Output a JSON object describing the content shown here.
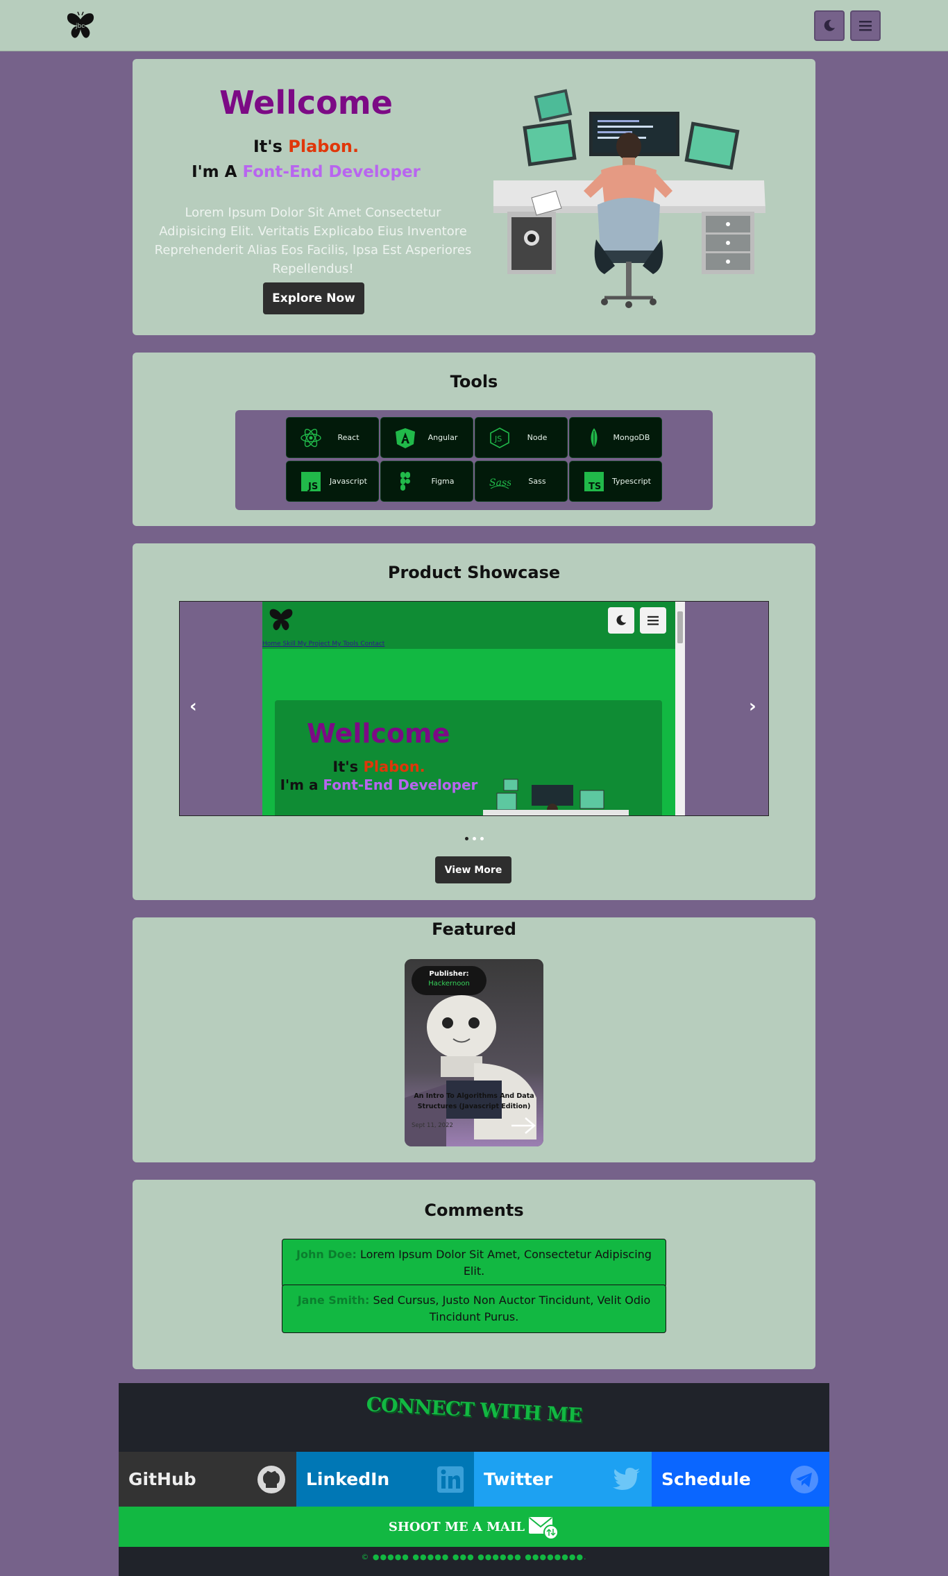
{
  "header": {
    "logo_icon": "butterfly-logo-icon",
    "theme_icon": "moon-icon",
    "menu_icon": "hamburger-menu-icon"
  },
  "hero": {
    "title": "Wellcome",
    "intro_prefix": "It's ",
    "intro_name": "Plabon.",
    "role_prefix": "I'm A ",
    "role": "Font-End Developer",
    "description": "Lorem Ipsum Dolor Sit Amet Consectetur Adipisicing Elit. Veritatis Explicabo Eius Inventore Reprehenderit Alias Eos Facilis, Ipsa Est Asperiores Repellendus!",
    "button_label": "Explore Now",
    "illustration": "developer-at-desk-illustration"
  },
  "tools": {
    "title": "Tools",
    "items": [
      {
        "label": "React",
        "icon": "react-icon"
      },
      {
        "label": "Angular",
        "icon": "angular-icon"
      },
      {
        "label": "Node",
        "icon": "nodejs-icon"
      },
      {
        "label": "MongoDB",
        "icon": "mongodb-icon"
      },
      {
        "label": "Javascript",
        "icon": "javascript-icon"
      },
      {
        "label": "Figma",
        "icon": "figma-icon"
      },
      {
        "label": "Sass",
        "icon": "sass-icon"
      },
      {
        "label": "Typescript",
        "icon": "typescript-icon"
      }
    ]
  },
  "showcase": {
    "title": "Product Showcase",
    "prev_label": "‹",
    "next_label": "›",
    "slide": {
      "nav_links": "Home Skill My Project My Tools Contact",
      "title": "Wellcome",
      "intro_prefix": "It's ",
      "intro_name": "Plabon.",
      "role_prefix": "I'm a ",
      "role": "Font-End Developer"
    },
    "slide_count": 3,
    "active_slide": 1,
    "button_label": "View More"
  },
  "featured": {
    "title": "Featured",
    "publisher_label": "Publisher:",
    "publisher_name": "Hackernoon",
    "article_title": "An Intro To Algorithms And Data Structures (Javascript Edition)",
    "date": "Sept 11, 2022",
    "arrow_icon": "arrow-right-icon"
  },
  "comments": {
    "title": "Comments",
    "items": [
      {
        "author": "John Doe:",
        "text": " Lorem Ipsum Dolor Sit Amet, Consectetur Adipiscing Elit."
      },
      {
        "author": "Jane Smith:",
        "text": " Sed Cursus, Justo Non Auctor Tincidunt, Velit Odio Tincidunt Purus."
      }
    ]
  },
  "footer": {
    "connect_title": "CONNECT WITH ME",
    "socials": [
      {
        "label": "GitHub",
        "icon": "github-icon",
        "color": "#333333"
      },
      {
        "label": "LinkedIn",
        "icon": "linkedin-icon",
        "color": "#0077b5"
      },
      {
        "label": "Twitter",
        "icon": "twitter-icon",
        "color": "#1da1f2"
      },
      {
        "label": "Schedule",
        "icon": "telegram-icon",
        "color": "#0a66ff"
      }
    ],
    "mail_label": "SHOOT ME A MAIL",
    "mail_icon": "mail-icon",
    "copyright": "© ●●●●● ●●●●● ●●● ●●●●●● ●●●●●●●●."
  },
  "colors": {
    "page_bg": "#76628a",
    "card_bg": "#b7cdbd",
    "accent_green": "#12b842",
    "title_purple": "#7c0a85",
    "name_orange": "#e0370a",
    "role_violet": "#b865ef"
  }
}
